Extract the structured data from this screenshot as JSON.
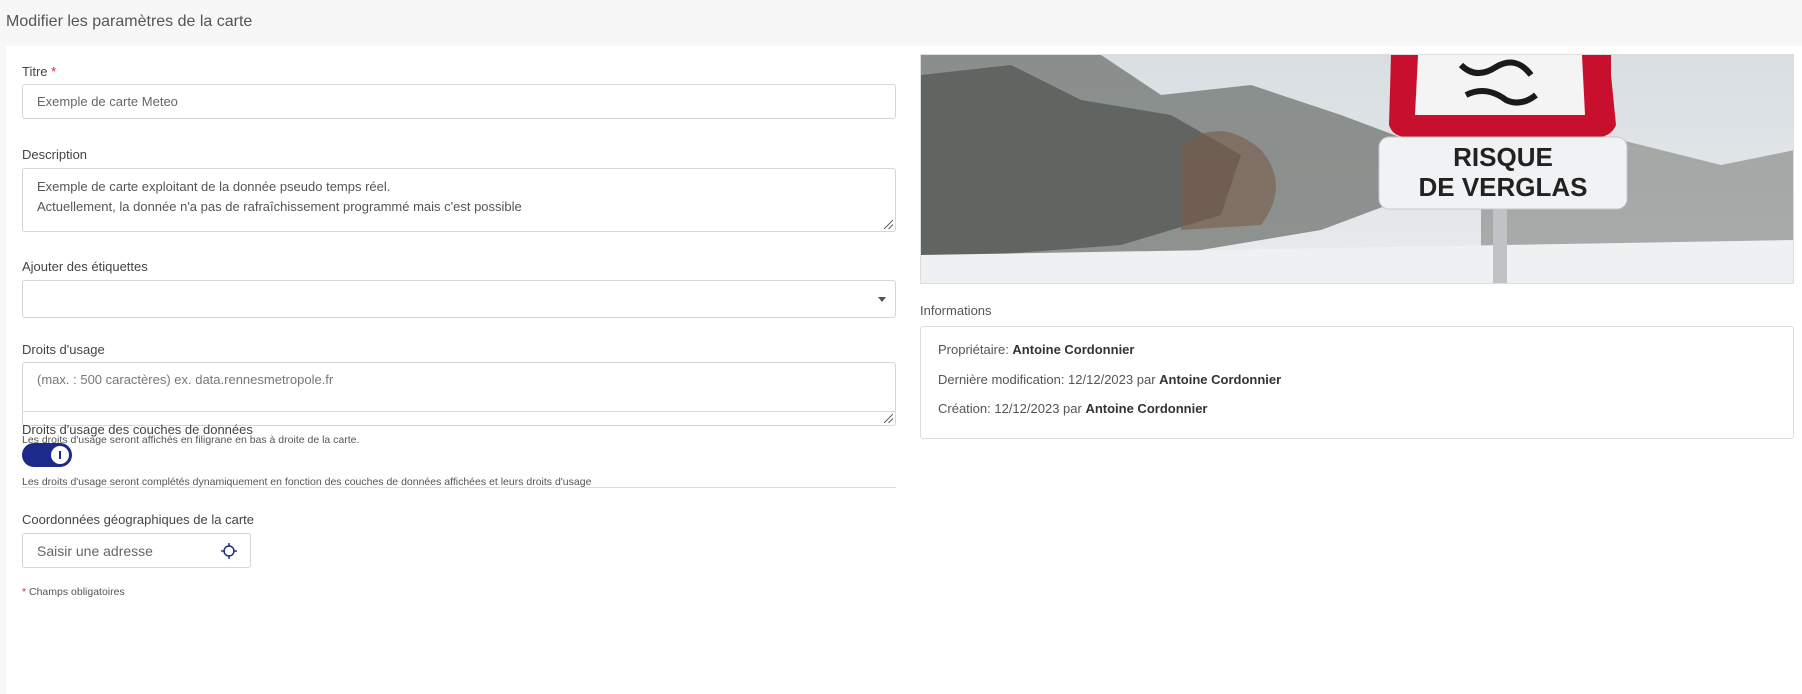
{
  "header": {
    "title": "Modifier les paramètres de la carte"
  },
  "form": {
    "title": {
      "label": "Titre",
      "required_mark": "*",
      "value": "Exemple de carte Meteo"
    },
    "description": {
      "label": "Description",
      "line1": "Exemple de carte exploitant de la donnée pseudo temps réel.",
      "line2": "Actuellement, la donnée n'a pas de rafraîchissement programmé mais c'est possible"
    },
    "tags": {
      "label": "Ajouter des étiquettes",
      "value": ""
    },
    "usage_rights": {
      "label": "Droits d'usage",
      "placeholder": "(max. : 500 caractères) ex. data.rennesmetropole.fr",
      "hint": "Les droits d'usage seront affichés en filigrane en bas à droite de la carte."
    },
    "layer_rights": {
      "label": "Droits d'usage des couches de données",
      "enabled": true,
      "hint": "Les droits d'usage seront complétés dynamiquement en fonction des couches de données affichées et leurs droits d'usage"
    },
    "coordinates": {
      "label": "Coordonnées géographiques de la carte",
      "placeholder": "Saisir une adresse"
    },
    "required_note": {
      "mark": "*",
      "text": " Champs obligatoires"
    }
  },
  "image": {
    "sign_line1": "RISQUE",
    "sign_line2": "DE VERGLAS"
  },
  "info": {
    "label": "Informations",
    "owner_label": "Propriétaire: ",
    "owner": "Antoine Cordonnier",
    "modified_label": "Dernière modification: 12/12/2023 par ",
    "modified_by": "Antoine Cordonnier",
    "created_label": "Création: 12/12/2023 par ",
    "created_by": "Antoine Cordonnier"
  },
  "colors": {
    "toggle_on": "#1c2a8a",
    "required": "#d9232e",
    "sign_red": "#c8102e"
  }
}
